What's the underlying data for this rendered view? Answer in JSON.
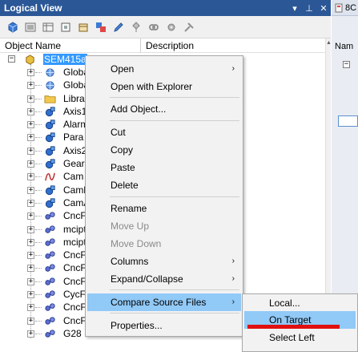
{
  "panel": {
    "title": "Logical View",
    "title_buttons": [
      "▾",
      "⊥",
      "✕"
    ],
    "columns": [
      "Object Name",
      "Description"
    ]
  },
  "tree": {
    "root": "SEM415a",
    "children": [
      "Globa",
      "Globa",
      "Libra",
      "Axis1",
      "Alarm",
      "Para",
      "Axis2",
      "Gear",
      "Cam",
      "Caml",
      "CamA",
      "CncF",
      "mcipt",
      "mcipt",
      "CncF",
      "CncF",
      "CncF",
      "CycF",
      "CncF",
      "CncF",
      "G28"
    ]
  },
  "right": {
    "tab_label": "8C",
    "column_label": "Nam"
  },
  "menu": {
    "items": [
      {
        "label": "Open",
        "submenu": true,
        "disabled": false
      },
      {
        "label": "Open with Explorer",
        "submenu": false,
        "disabled": false
      },
      {
        "label": "Add Object...",
        "submenu": false,
        "disabled": false
      },
      {
        "label": "Cut",
        "submenu": false,
        "disabled": false
      },
      {
        "label": "Copy",
        "submenu": false,
        "disabled": false
      },
      {
        "label": "Paste",
        "submenu": false,
        "disabled": false
      },
      {
        "label": "Delete",
        "submenu": false,
        "disabled": false
      },
      {
        "label": "Rename",
        "submenu": false,
        "disabled": false
      },
      {
        "label": "Move Up",
        "submenu": false,
        "disabled": true
      },
      {
        "label": "Move Down",
        "submenu": false,
        "disabled": true
      },
      {
        "label": "Columns",
        "submenu": true,
        "disabled": false
      },
      {
        "label": "Expand/Collapse",
        "submenu": true,
        "disabled": false
      },
      {
        "label": "Compare Source Files",
        "submenu": true,
        "disabled": false,
        "highlighted": true
      },
      {
        "label": "Properties...",
        "submenu": false,
        "disabled": false
      }
    ],
    "submenu_arrow": "›"
  },
  "submenu": {
    "items": [
      {
        "label": "Local..."
      },
      {
        "label": "On Target",
        "highlighted": true
      },
      {
        "label": "Select Left"
      }
    ]
  },
  "colors": {
    "titlebar": "#2b5797",
    "selection": "#3399ff",
    "menu_hover": "#91c9f7",
    "annotation_underline": "#e01010"
  }
}
